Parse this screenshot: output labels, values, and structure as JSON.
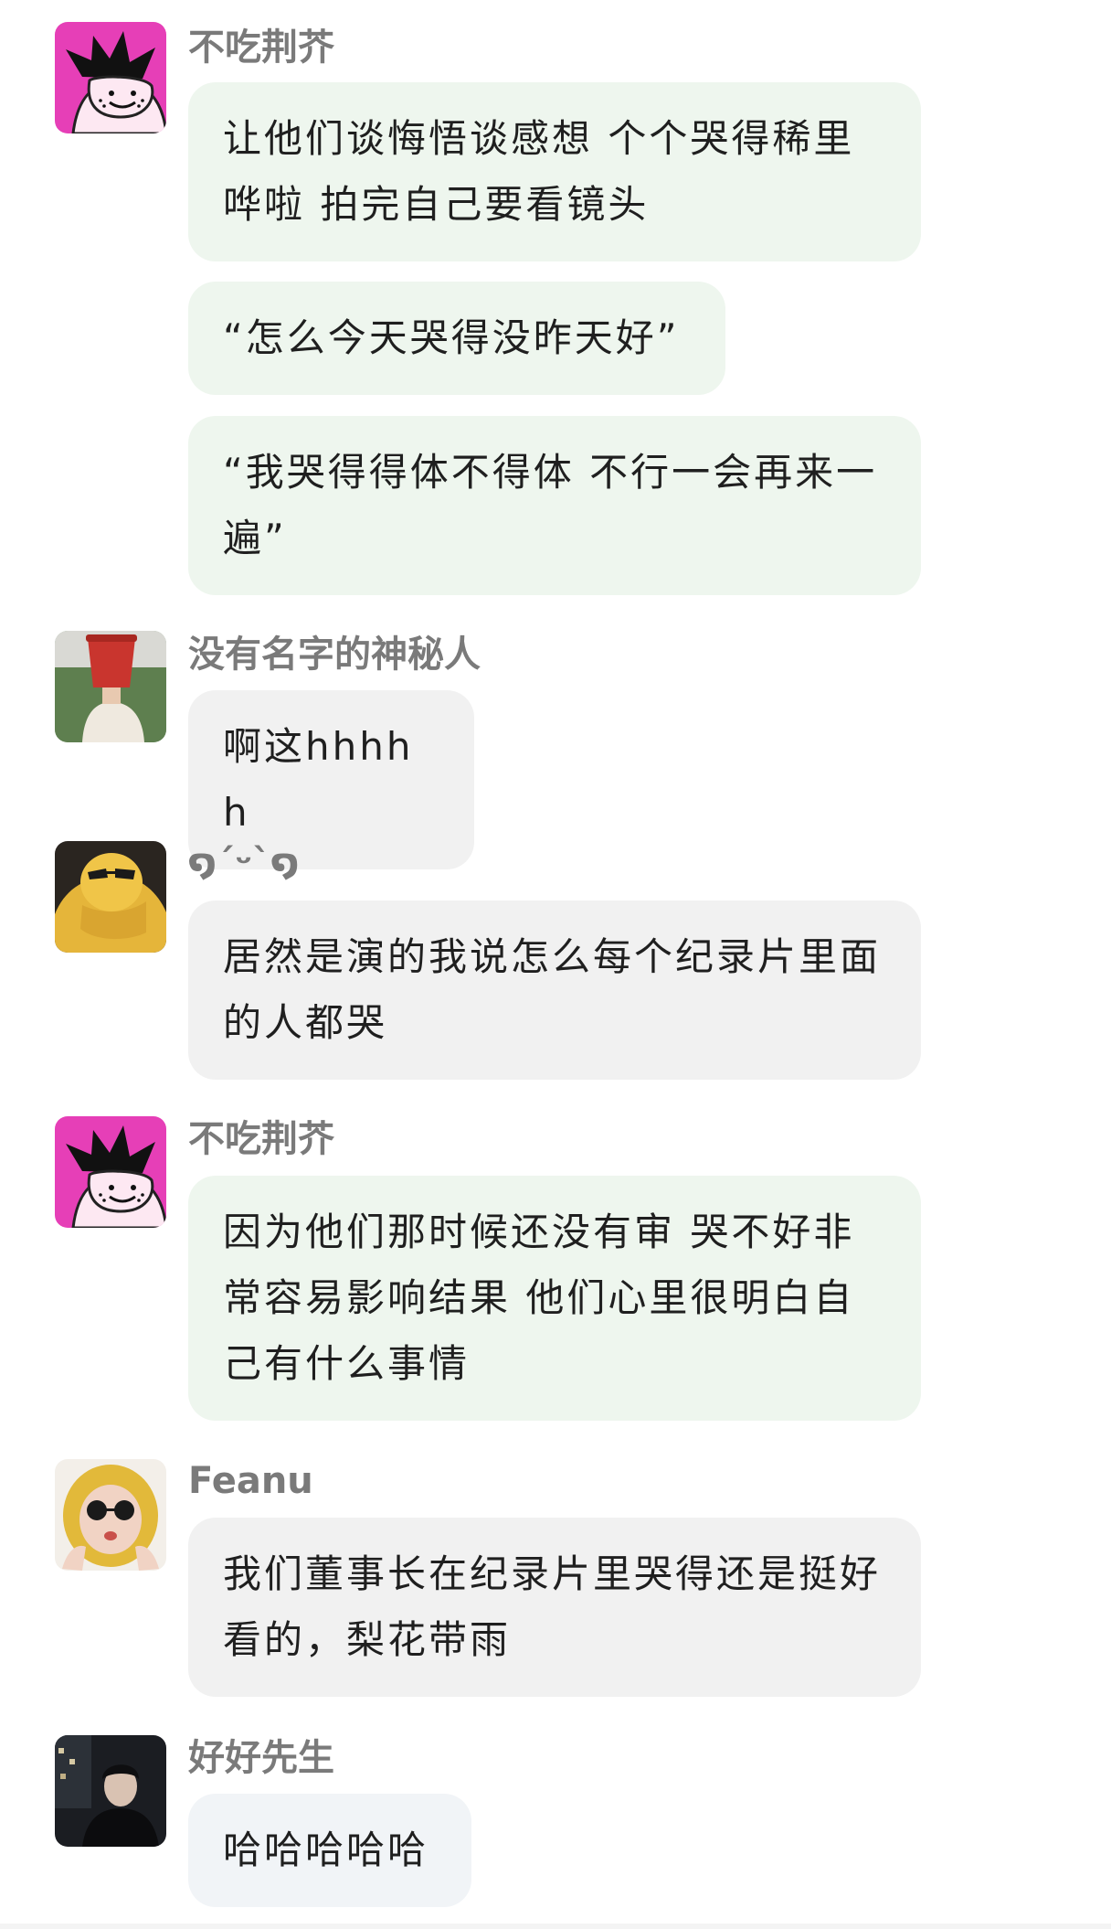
{
  "messages": [
    {
      "user": "不吃荆芥",
      "bubbles": [
        "让他们谈悔悟谈感想 个个哭得稀里哗啦 拍完自己要看镜头",
        "“怎么今天哭得没昨天好”",
        "“我哭得得体不得体 不行一会再来一遍”"
      ]
    },
    {
      "user": "没有名字的神秘人",
      "bubbles": [
        "啊这hhhhh"
      ]
    },
    {
      "user": "໑´ᵕ`໑",
      "bubbles": [
        "居然是演的我说怎么每个纪录片里面的人都哭"
      ]
    },
    {
      "user": "不吃荆芥",
      "bubbles": [
        "因为他们那时候还没有审 哭不好非常容易影响结果 他们心里很明白自己有什么事情"
      ]
    },
    {
      "user": "Feanu",
      "bubbles": [
        "我们董事长在纪录片里哭得还是挺好看的，梨花带雨"
      ]
    },
    {
      "user": "好好先生",
      "bubbles": [
        "哈哈哈哈哈"
      ]
    }
  ],
  "colors": {
    "bubble_green": "#eef6ee",
    "bubble_gray": "#f1f1f1",
    "bubble_blue": "#f1f4f7",
    "nickname": "#7a7a7a",
    "text": "#1f1f1f"
  }
}
